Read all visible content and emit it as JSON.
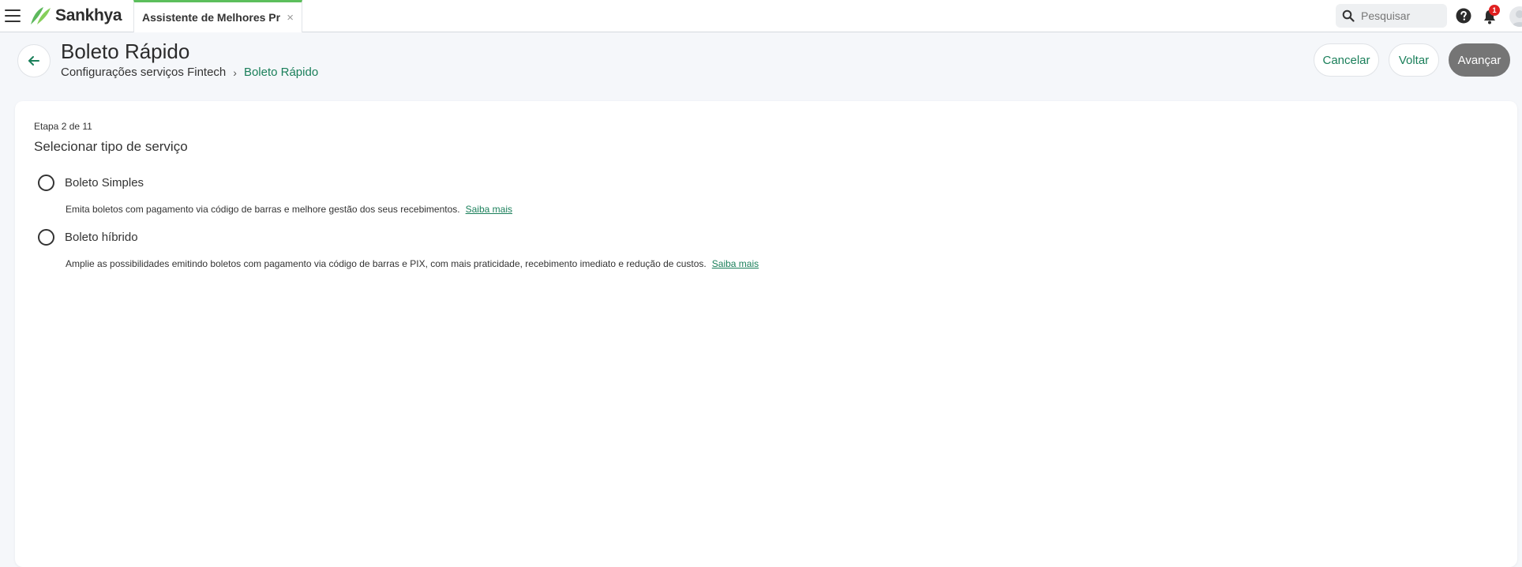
{
  "topbar": {
    "brand": "Sankhya",
    "tab_label": "Assistente de Melhores Pr...",
    "tab_close": "×",
    "search_placeholder": "Pesquisar",
    "notification_count": "1",
    "accent_color": "#5cbf5c"
  },
  "header": {
    "title": "Boleto Rápido",
    "breadcrumb": {
      "root": "Configurações serviços Fintech",
      "separator": "›",
      "current": "Boleto Rápido"
    },
    "buttons": {
      "cancel": "Cancelar",
      "back": "Voltar",
      "next": "Avançar"
    }
  },
  "wizard": {
    "step": "Etapa 2 de 11",
    "section_title": "Selecionar tipo de serviço",
    "options": [
      {
        "label": "Boleto Simples",
        "description": "Emita boletos com pagamento via código de barras e melhore gestão dos seus recebimentos.",
        "link": "Saiba mais",
        "selected": false
      },
      {
        "label": "Boleto híbrido",
        "description": "Amplie as possibilidades emitindo boletos com pagamento via código de barras e PIX, com mais praticidade, recebimento imediato e redução de custos.",
        "link": "Saiba mais",
        "selected": false
      }
    ]
  },
  "colors": {
    "link_green": "#1a7f5a",
    "primary_disabled": "#757575",
    "notification_red": "#e02020"
  }
}
